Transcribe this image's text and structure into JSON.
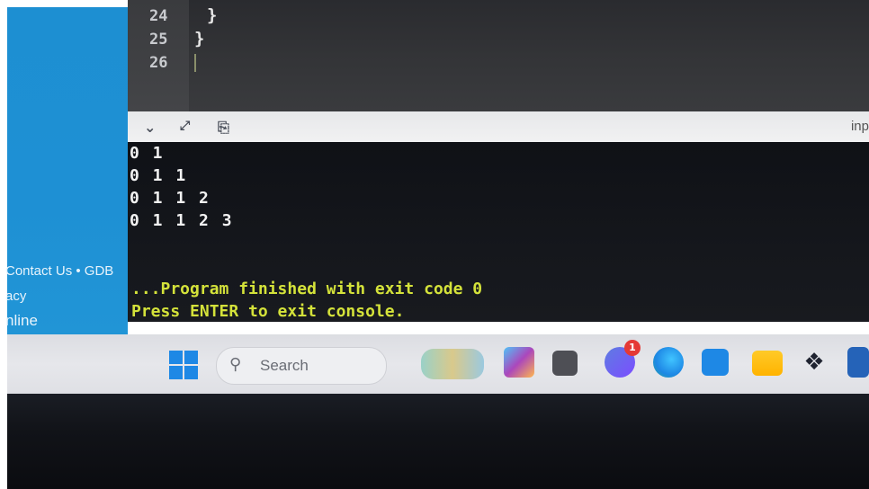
{
  "editor": {
    "lines": [
      {
        "number": "24",
        "code": "}"
      },
      {
        "number": "25",
        "code": "}"
      },
      {
        "number": "26",
        "code": ""
      }
    ]
  },
  "console_toolbar": {
    "collapse_icon": "chevron-down-icon",
    "expand_icon": "expand-icon",
    "copy_icon": "copy-icon",
    "input_label": "inp"
  },
  "console": {
    "output_lines": [
      "0 1",
      "0 1 1",
      "0 1 1 2",
      "0 1 1 2 3"
    ],
    "finished_message": "...Program finished with exit code 0",
    "exit_prompt": "Press ENTER to exit console."
  },
  "left_footer": {
    "line1": "Contact Us • GDB",
    "line2": "acy",
    "line3": "nline"
  },
  "taskbar": {
    "search_placeholder": "Search",
    "notification_count": "1",
    "icons": [
      "start-icon",
      "widgets-icon",
      "app-icon",
      "file-viewer-icon",
      "chat-icon",
      "edge-icon",
      "store-icon",
      "file-explorer-icon",
      "dropbox-icon",
      "app-icon-partial"
    ]
  },
  "colors": {
    "console_bg": "#14161b",
    "message_text": "#d4e23a",
    "left_panel": "#1e90d4",
    "edge_blue": "#1e88e5"
  }
}
